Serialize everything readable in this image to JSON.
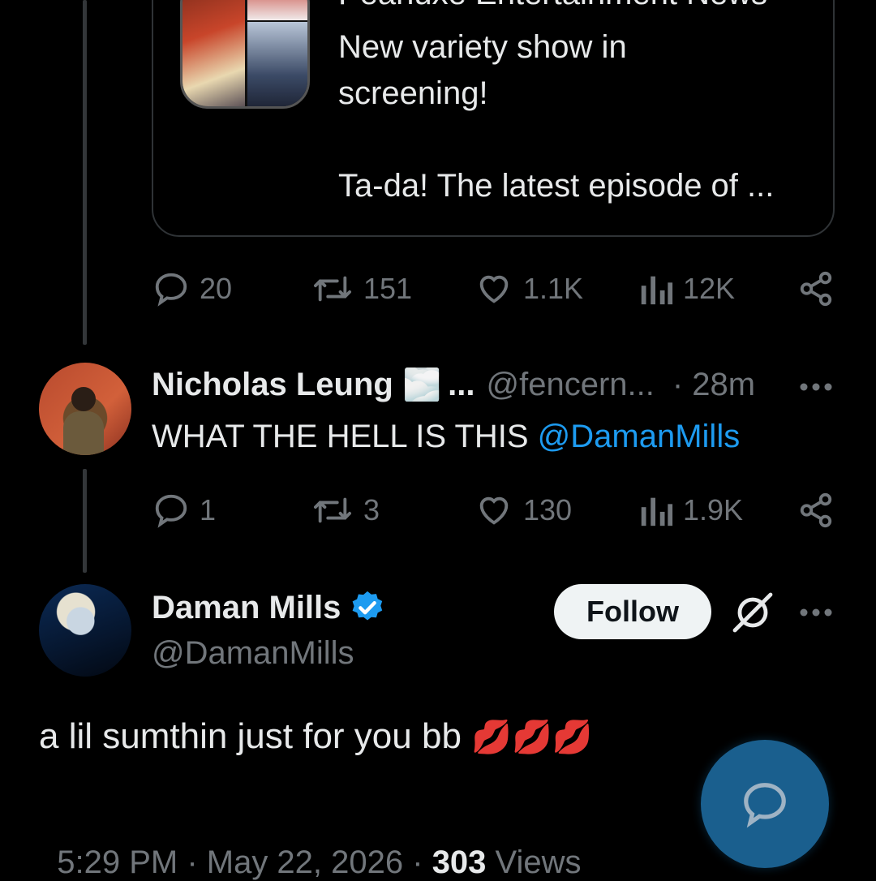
{
  "quoted": {
    "source_line": "Peanuxe Entertainment News",
    "line1": "New variety show in",
    "line2": "screening!",
    "line3": "Ta-da! The latest episode of ..."
  },
  "quoted_actions": {
    "replies": "20",
    "reposts": "151",
    "likes": "1.1K",
    "views": "12K"
  },
  "reply": {
    "name": "Nicholas Leung",
    "name_emoji": "🌫️",
    "name_ellipsis": "...",
    "handle": "@fencern...",
    "time": "· 28m",
    "text": "WHAT THE HELL IS THIS ",
    "mention": "@DamanMills",
    "actions": {
      "replies": "1",
      "reposts": "3",
      "likes": "130",
      "views": "1.9K"
    }
  },
  "main_post": {
    "name": "Daman Mills",
    "handle": "@DamanMills",
    "follow_label": "Follow",
    "text": "a lil sumthin just for you bb ",
    "emoji": "💋💋💋",
    "time": "5:29 PM",
    "sep1": " · ",
    "date": "May 22, 2026",
    "sep2": " · ",
    "views_count": "303",
    "views_label": " Views"
  },
  "colors": {
    "background": "#000000",
    "text": "#e7e9ea",
    "muted": "#71767b",
    "accent": "#1d9bf0",
    "fab": "#1a5f8e"
  },
  "icons": [
    "reply-icon",
    "repost-icon",
    "like-icon",
    "views-icon",
    "share-icon",
    "more-icon",
    "verified-icon",
    "grok-icon",
    "compose-reply-icon"
  ]
}
